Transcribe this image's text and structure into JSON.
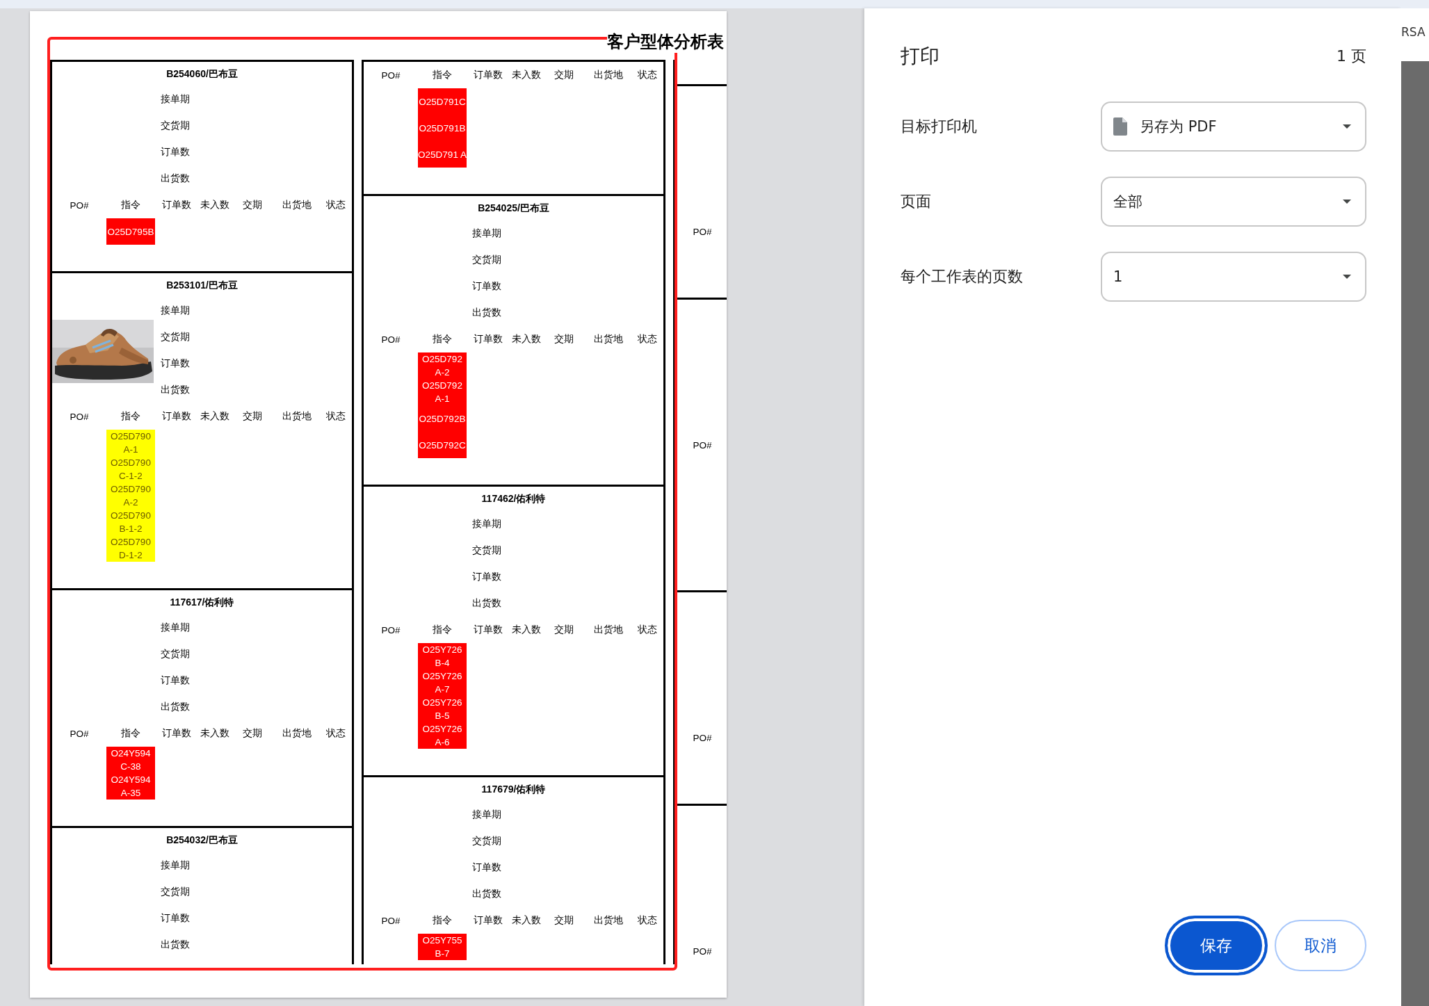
{
  "sheet": {
    "title": "客户型体分析表",
    "columns": [
      {
        "kind": "full",
        "blocks": [
          {
            "title": "B254060/巴布豆",
            "fields": [
              "接单期",
              "交货期",
              "订单数",
              "出货数"
            ],
            "columns": [
              "PO#",
              "指令",
              "订单数",
              "未入数",
              "交期",
              "出货地",
              "状态"
            ],
            "color": "#ff0000",
            "codes": [
              "O25D795B"
            ]
          },
          {
            "title": "B253101/巴布豆",
            "photo": {
              "kind": "picture"
            },
            "fields": [
              "接单期",
              "交货期",
              "订单数",
              "出货数"
            ],
            "columns": [
              "PO#",
              "指令",
              "订单数",
              "未入数",
              "交期",
              "出货地",
              "状态"
            ],
            "color": "#ffff00",
            "codes": [
              "O25D790 A-1",
              "O25D790 C-1-2",
              "O25D790 A-2",
              "O25D790 B-1-2",
              "O25D790 D-1-2"
            ]
          },
          {
            "title": "117617/佑利特",
            "fields": [
              "接单期",
              "交货期",
              "订单数",
              "出货数"
            ],
            "columns": [
              "PO#",
              "指令",
              "订单数",
              "未入数",
              "交期",
              "出货地",
              "状态"
            ],
            "color": "#ff0000",
            "codes": [
              "O24Y594 C-38",
              "O24Y594 A-35"
            ]
          },
          {
            "title": "B254032/巴布豆",
            "fields": [
              "接单期",
              "交货期",
              "订单数",
              "出货数"
            ]
          }
        ]
      },
      {
        "kind": "full",
        "blocks": [
          {
            "columns": [
              "PO#",
              "指令",
              "订单数",
              "未入数",
              "交期",
              "出货地",
              "状态"
            ],
            "color": "#ff0000",
            "codes": [
              "O25D791C",
              "O25D791B",
              "O25D791 A"
            ]
          },
          {
            "title": "B254025/巴布豆",
            "fields": [
              "接单期",
              "交货期",
              "订单数",
              "出货数"
            ],
            "columns": [
              "PO#",
              "指令",
              "订单数",
              "未入数",
              "交期",
              "出货地",
              "状态"
            ],
            "color": "#ff0000",
            "codes": [
              "O25D792 A-2",
              "O25D792 A-1",
              "O25D792B",
              "O25D792C"
            ]
          },
          {
            "title": "117462/佑利特",
            "fields": [
              "接单期",
              "交货期",
              "订单数",
              "出货数"
            ],
            "columns": [
              "PO#",
              "指令",
              "订单数",
              "未入数",
              "交期",
              "出货地",
              "状态"
            ],
            "color": "#ff0000",
            "codes": [
              "O25Y726 B-4",
              "O25Y726 A-7",
              "O25Y726 B-5",
              "O25Y726 A-6"
            ]
          },
          {
            "title": "117679/佑利特",
            "fields": [
              "接单期",
              "交货期",
              "订单数",
              "出货数"
            ],
            "columns": [
              "PO#",
              "指令",
              "订单数",
              "未入数",
              "交期",
              "出货地",
              "状态"
            ],
            "color": "#ff0000",
            "codes": [
              "O25Y755 B-7"
            ]
          }
        ]
      },
      {
        "kind": "edge",
        "blocks": [
          {
            "columns": [
              "PO#"
            ]
          },
          {
            "columns": [
              "PO#"
            ]
          },
          {
            "columns": [
              "PO#"
            ]
          },
          {
            "columns": [
              "PO#"
            ]
          }
        ]
      }
    ]
  },
  "dialog": {
    "title": "打印",
    "page_count": "1 页",
    "settings": [
      {
        "label": "目标打印机",
        "kind": "printer",
        "value": "另存为 PDF"
      },
      {
        "label": "页面",
        "kind": "select",
        "value": "全部"
      },
      {
        "label": "每个工作表的页数",
        "kind": "select",
        "value": "1"
      }
    ],
    "buttons": [
      {
        "label": "保存",
        "kind": "primary"
      },
      {
        "label": "取消",
        "kind": "secondary"
      }
    ]
  },
  "background_tab": {
    "text": "RSA"
  }
}
